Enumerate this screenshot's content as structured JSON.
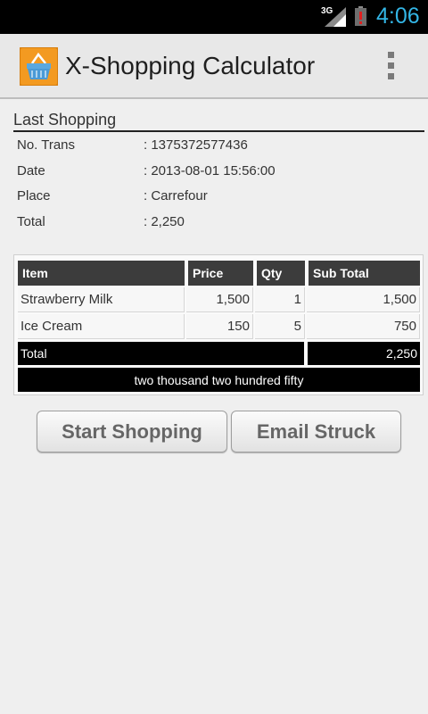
{
  "status_bar": {
    "network": "3G",
    "time": "4:06",
    "clock_color": "#33b5e5",
    "battery_icon": "battery-alert-icon",
    "signal_icon": "signal-icon"
  },
  "action_bar": {
    "title": "X-Shopping Calculator",
    "app_icon": "shopping-basket-icon",
    "menu_icon": "overflow-menu-icon"
  },
  "last_shopping": {
    "heading": "Last Shopping",
    "rows": [
      {
        "label": "No. Trans",
        "value": ": 1375372577436"
      },
      {
        "label": "Date",
        "value": ": 2013-08-01 15:56:00"
      },
      {
        "label": "Place",
        "value": ": Carrefour"
      },
      {
        "label": "Total",
        "value": ": 2,250"
      }
    ]
  },
  "table": {
    "headers": [
      "Item",
      "Price",
      "Qty",
      "Sub Total"
    ],
    "rows": [
      {
        "item": "Strawberry Milk",
        "price": "1,500",
        "qty": "1",
        "subtotal": "1,500"
      },
      {
        "item": "Ice Cream",
        "price": "150",
        "qty": "5",
        "subtotal": "750"
      }
    ],
    "total_label": "Total",
    "total_value": "2,250",
    "total_words": "two thousand two hundred fifty"
  },
  "buttons": {
    "start": "Start Shopping",
    "email": "Email Struck"
  }
}
